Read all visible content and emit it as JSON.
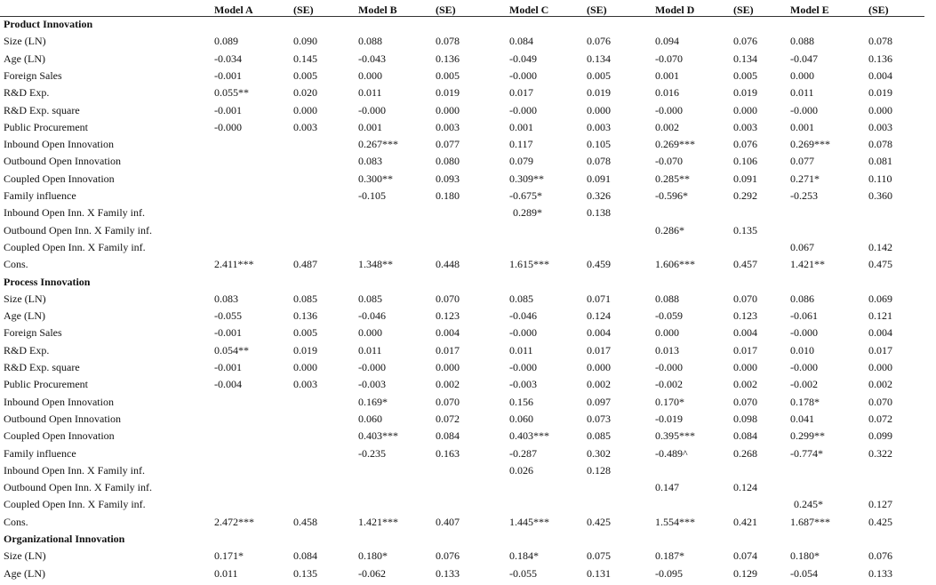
{
  "header": [
    "Model A",
    "(SE)",
    "Model B",
    "(SE)",
    "Model C",
    "(SE)",
    "Model D",
    "(SE)",
    "Model E",
    "(SE)"
  ],
  "sections": [
    {
      "title": "Product Innovation",
      "rows": [
        {
          "label": "Size (LN)",
          "values": [
            "0.089",
            "0.090",
            "0.088",
            "0.078",
            "0.084",
            "0.076",
            "0.094",
            "0.076",
            "0.088",
            "0.078"
          ]
        },
        {
          "label": "Age (LN)",
          "values": [
            "-0.034",
            "0.145",
            "-0.043",
            "0.136",
            "-0.049",
            "0.134",
            "-0.070",
            "0.134",
            "-0.047",
            "0.136"
          ]
        },
        {
          "label": "Foreign Sales",
          "values": [
            "-0.001",
            "0.005",
            "0.000",
            "0.005",
            "-0.000",
            "0.005",
            "0.001",
            "0.005",
            "0.000",
            "0.004"
          ]
        },
        {
          "label": "R&D Exp.",
          "values": [
            "0.055**",
            "0.020",
            "0.011",
            "0.019",
            "0.017",
            "0.019",
            "0.016",
            "0.019",
            "0.011",
            "0.019"
          ]
        },
        {
          "label": "R&D Exp. square",
          "values": [
            "-0.001",
            "0.000",
            "-0.000",
            "0.000",
            "-0.000",
            "0.000",
            "-0.000",
            "0.000",
            "-0.000",
            "0.000"
          ]
        },
        {
          "label": "Public Procurement",
          "values": [
            "-0.000",
            "0.003",
            "0.001",
            "0.003",
            "0.001",
            "0.003",
            "0.002",
            "0.003",
            "0.001",
            "0.003"
          ]
        },
        {
          "label": "Inbound Open Innovation",
          "values": [
            "",
            "",
            "0.267***",
            "0.077",
            "0.117",
            "0.105",
            "0.269***",
            "0.076",
            "0.269***",
            "0.078"
          ]
        },
        {
          "label": "Outbound Open Innovation",
          "values": [
            "",
            "",
            "0.083",
            "0.080",
            "0.079",
            "0.078",
            "-0.070",
            "0.106",
            "0.077",
            "0.081"
          ]
        },
        {
          "label": "Coupled Open Innovation",
          "values": [
            "",
            "",
            "0.300**",
            "0.093",
            "0.309**",
            "0.091",
            "0.285**",
            "0.091",
            "0.271*",
            "0.110"
          ]
        },
        {
          "label": "Family influence",
          "values": [
            "",
            "",
            "-0.105",
            "0.180",
            "-0.675*",
            "0.326",
            "-0.596*",
            "0.292",
            "-0.253",
            "0.360"
          ]
        },
        {
          "label": "Inbound Open Inn. X Family inf.",
          "values": [
            "",
            "",
            "",
            "",
            " 0.289*",
            "0.138",
            "",
            "",
            "",
            ""
          ]
        },
        {
          "label": "Outbound Open Inn. X Family inf.",
          "values": [
            "",
            "",
            "",
            "",
            "",
            "",
            "0.286*",
            "0.135",
            "",
            ""
          ]
        },
        {
          "label": "Coupled Open Inn. X Family inf.",
          "values": [
            "",
            "",
            "",
            "",
            "",
            "",
            "",
            "",
            "0.067",
            "0.142"
          ]
        },
        {
          "label": "Cons.",
          "values": [
            "2.411***",
            "0.487",
            "1.348**",
            "0.448",
            "1.615***",
            "0.459",
            "1.606***",
            "0.457",
            "1.421**",
            "0.475"
          ]
        }
      ]
    },
    {
      "title": "Process Innovation",
      "rows": [
        {
          "label": "Size (LN)",
          "values": [
            "0.083",
            "0.085",
            "0.085",
            "0.070",
            "0.085",
            "0.071",
            "0.088",
            "0.070",
            "0.086",
            "0.069"
          ]
        },
        {
          "label": "Age (LN)",
          "values": [
            "-0.055",
            "0.136",
            "-0.046",
            "0.123",
            "-0.046",
            "0.124",
            "-0.059",
            "0.123",
            "-0.061",
            "0.121"
          ]
        },
        {
          "label": "Foreign Sales",
          "values": [
            "-0.001",
            "0.005",
            "0.000",
            "0.004",
            "-0.000",
            "0.004",
            "0.000",
            "0.004",
            "-0.000",
            "0.004"
          ]
        },
        {
          "label": "R&D Exp.",
          "values": [
            "0.054**",
            "0.019",
            "0.011",
            "0.017",
            "0.011",
            "0.017",
            "0.013",
            "0.017",
            "0.010",
            "0.017"
          ]
        },
        {
          "label": "R&D Exp. square",
          "values": [
            "-0.001",
            "0.000",
            "-0.000",
            "0.000",
            "-0.000",
            "0.000",
            "-0.000",
            "0.000",
            "-0.000",
            "0.000"
          ]
        },
        {
          "label": "Public Procurement",
          "values": [
            "-0.004",
            "0.003",
            "-0.003",
            "0.002",
            "-0.003",
            "0.002",
            "-0.002",
            "0.002",
            "-0.002",
            "0.002"
          ]
        },
        {
          "label": "Inbound Open Innovation",
          "values": [
            "",
            "",
            "0.169*",
            "0.070",
            "0.156",
            "0.097",
            "0.170*",
            "0.070",
            "0.178*",
            "0.070"
          ]
        },
        {
          "label": "Outbound Open Innovation",
          "values": [
            "",
            "",
            "0.060",
            "0.072",
            "0.060",
            "0.073",
            "-0.019",
            "0.098",
            "0.041",
            "0.072"
          ]
        },
        {
          "label": "Coupled Open Innovation",
          "values": [
            "",
            "",
            "0.403***",
            "0.084",
            "0.403***",
            "0.085",
            "0.395***",
            "0.084",
            "0.299**",
            "0.099"
          ]
        },
        {
          "label": "Family influence",
          "values": [
            "",
            "",
            "-0.235",
            "0.163",
            "-0.287",
            "0.302",
            "-0.489^",
            "0.268",
            "-0.774*",
            "0.322"
          ]
        },
        {
          "label": "Inbound Open Inn. X Family inf.",
          "values": [
            "",
            "",
            "",
            "",
            "0.026",
            "0.128",
            "",
            "",
            "",
            ""
          ]
        },
        {
          "label": "Outbound Open Inn. X Family inf.",
          "values": [
            "",
            "",
            "",
            "",
            "",
            "",
            "0.147",
            "0.124",
            "",
            ""
          ]
        },
        {
          "label": "Coupled Open Inn. X Family inf.",
          "values": [
            "",
            "",
            "",
            "",
            "",
            "",
            "",
            "",
            " 0.245*",
            "0.127"
          ]
        },
        {
          "label": "Cons.",
          "values": [
            "2.472***",
            "0.458",
            "1.421***",
            "0.407",
            "1.445***",
            "0.425",
            "1.554***",
            "0.421",
            "1.687***",
            "0.425"
          ]
        }
      ]
    },
    {
      "title": "Organizational Innovation",
      "rows": [
        {
          "label": "Size (LN)",
          "values": [
            "0.171*",
            "0.084",
            "0.180*",
            "0.076",
            "0.184*",
            "0.075",
            "0.187*",
            "0.074",
            "0.180*",
            "0.076"
          ]
        },
        {
          "label": "Age (LN)",
          "values": [
            "0.011",
            "0.135",
            "-0.062",
            "0.133",
            "-0.055",
            "0.131",
            "-0.095",
            "0.129",
            "-0.054",
            "0.133"
          ]
        }
      ]
    }
  ]
}
